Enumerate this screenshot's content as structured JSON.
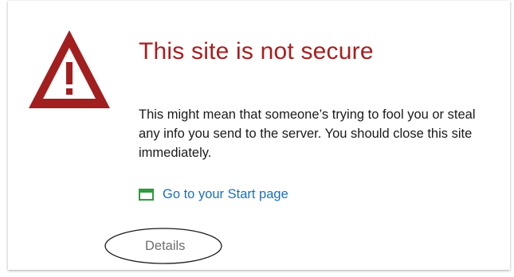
{
  "colors": {
    "title": "#a81e1e",
    "icon_red": "#a21f1f",
    "link": "#1a6fc0",
    "start_icon_green": "#2e9b3c",
    "details_text": "#6e6e6e"
  },
  "warning": {
    "icon": "warning-triangle-icon",
    "title": "This site is not secure",
    "message": "This might mean that someone’s trying to fool you or steal any info you send to the server. You should close this site immediately."
  },
  "actions": {
    "start_page": {
      "icon": "browser-window-icon",
      "label": "Go to your Start page"
    },
    "details": {
      "label": "Details"
    }
  }
}
